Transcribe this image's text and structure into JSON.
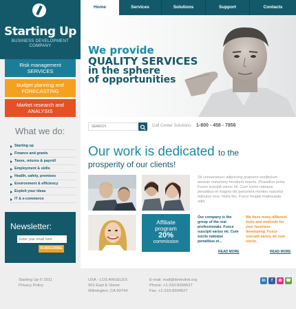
{
  "brand": {
    "title": "Starting Up",
    "subtitle_line1": "BUSINESS DEVELOPMENT",
    "subtitle_line2": "COMPANY"
  },
  "nav": {
    "items": [
      {
        "label": "Home"
      },
      {
        "label": "Services"
      },
      {
        "label": "Solutions"
      },
      {
        "label": "Support"
      },
      {
        "label": "Contacts"
      }
    ]
  },
  "side_menu": [
    {
      "line1": "Risk management",
      "line2": "SERVICES",
      "color": "#1b7e98"
    },
    {
      "line1": "Budget planning and",
      "line2": "FORECASTING",
      "color": "#f5a01e"
    },
    {
      "line1": "Market research and",
      "line2": "ANALYSIS",
      "color": "#e55124"
    }
  ],
  "what_we_do": {
    "title": "What we do:",
    "items": [
      "Starting up",
      "Finance and grants",
      "Taxes, returns & payroll",
      "Employment & skills",
      "Health, safety, premises",
      "Environment & efficiency",
      "Exploit your ideas",
      "IT & e-commerce"
    ]
  },
  "newsletter": {
    "title": "Newsletter:",
    "placeholder": "Enter your email here",
    "button": "SUBSCRIBE"
  },
  "hero": {
    "line1": "We provide",
    "line2": "QUALITY SERVICES",
    "line3": "in the sphere",
    "line4": "of opportunities"
  },
  "search": {
    "placeholder": "SEARCH",
    "phone_label": "Call Center Solutions:",
    "phone": "1-800 - 458 - 7856"
  },
  "main": {
    "headline_big": "Our work is dedicated",
    "headline_small": "to the",
    "headline_line2": "prosperity of our clients!",
    "para1": "Sit consectetuer adipiscing praesent vestibulum aenean nonummy hendrerit mauris. Phasellus porta. Fusce suscipit varius mi. Cum sociis natoque penatibus et magnis dis parturient montes nascetur ridiculus mus. Nulla dui. Fusce feugiat malesuada odio.",
    "affiliate": {
      "line1": "Affiliate",
      "line2": "program",
      "percent": "20%",
      "line4": "commission"
    },
    "col1": "Our company is the group of the real professionals. Fusce suscipit varius mi. Cum sociis natoque penatibus et...",
    "col2": "We have many different tools and methods for your business developing. Fusce suscipit varius mi cum sociis.",
    "read_more_1": "READ MORE",
    "read_more_2": "READ MORE"
  },
  "footer": {
    "copyright": "Starting Up © 2011",
    "privacy": "Privacy Policy",
    "address_city": "USA - LOS ANGELES",
    "address_street": "901 East E Street",
    "address_zip": "Wilmington, CA 90744",
    "email": "E-mail: mail@demolink.org",
    "phone": "Phone: +1-310-8394527",
    "fax": "Fax: +1-310-8394527"
  },
  "social": [
    {
      "name": "linkedin-icon",
      "glyph": "in",
      "color": "#2f7fb6"
    },
    {
      "name": "facebook-icon",
      "glyph": "f",
      "color": "#3a5da2"
    },
    {
      "name": "social-pink-icon",
      "glyph": "✿",
      "color": "#d9338a"
    },
    {
      "name": "social-green-icon",
      "glyph": "☎",
      "color": "#5aaa2e"
    }
  ]
}
